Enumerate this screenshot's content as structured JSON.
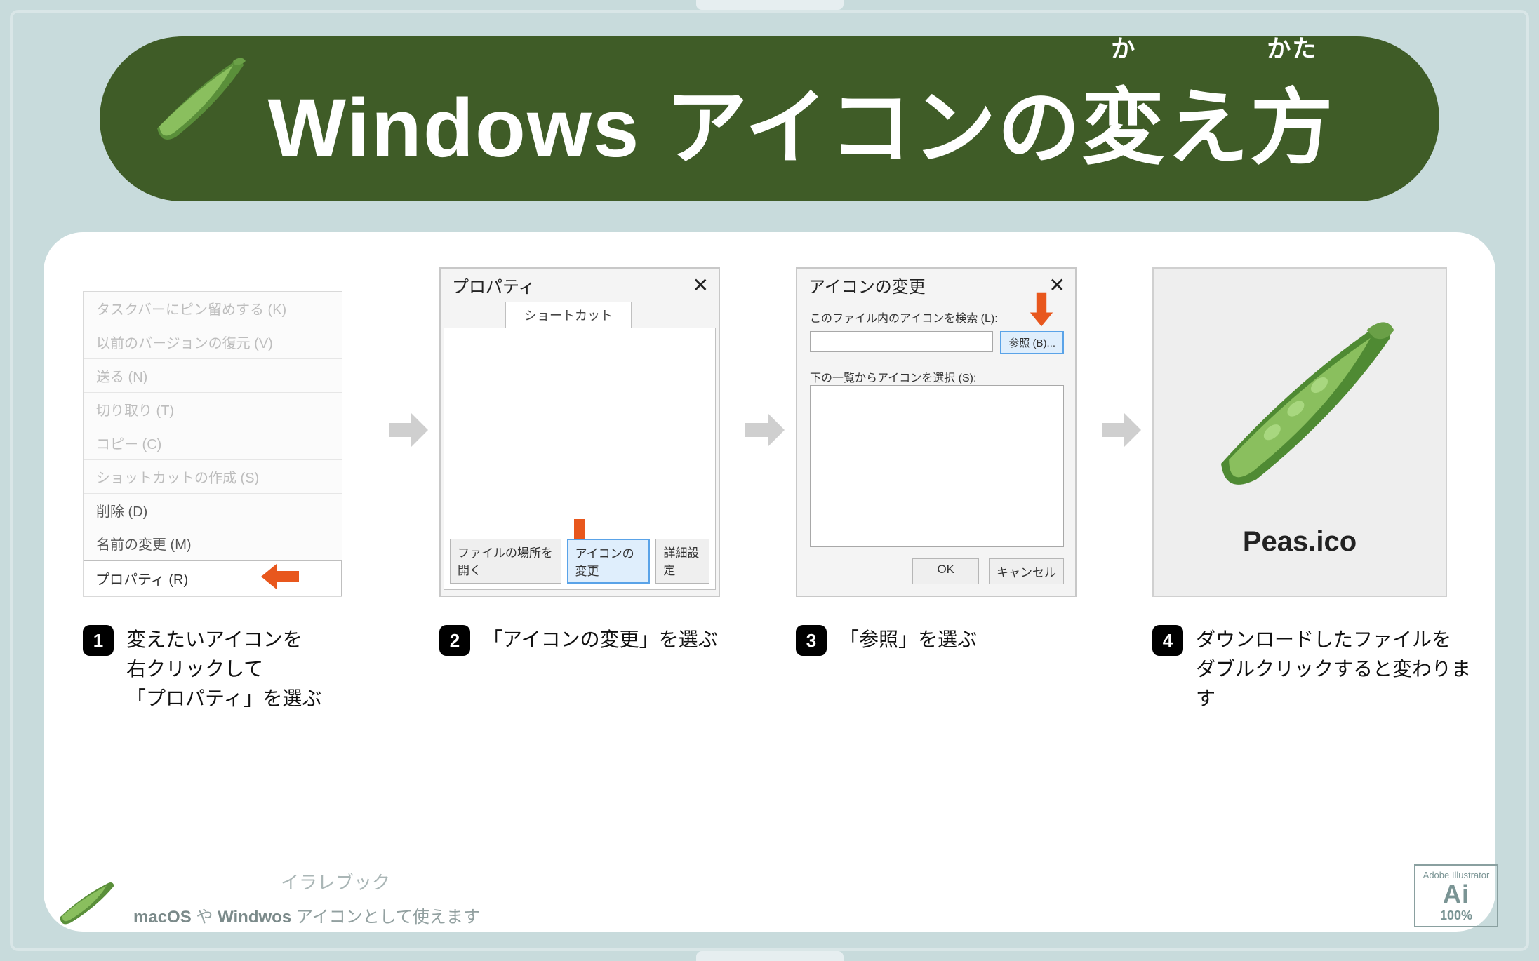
{
  "title": {
    "main": "Windows アイコンの",
    "ruby1_base": "変",
    "ruby1_kana": "か",
    "middle": "え",
    "ruby2_base": "方",
    "ruby2_kana": "かた"
  },
  "steps": {
    "s1": {
      "num": "1",
      "caption_l1": "変えたいアイコンを",
      "caption_l2": "右クリックして",
      "caption_l3": "「プロパティ」を選ぶ",
      "menu": {
        "pin": "タスクバーにピン留めする (K)",
        "restore": "以前のバージョンの復元 (V)",
        "send": "送る (N)",
        "cut": "切り取り (T)",
        "copy": "コピー (C)",
        "shortcut": "ショットカットの作成 (S)",
        "delete": "削除 (D)",
        "rename": "名前の変更 (M)",
        "props": "プロパティ (R)"
      }
    },
    "s2": {
      "num": "2",
      "caption": "「アイコンの変更」を選ぶ",
      "dlg_title": "プロパティ",
      "tab": "ショートカット",
      "btn_open": "ファイルの場所を開く",
      "btn_change": "アイコンの変更",
      "btn_adv": "詳細設定"
    },
    "s3": {
      "num": "3",
      "caption": "「参照」を選ぶ",
      "dlg_title": "アイコンの変更",
      "label_search": "このファイル内のアイコンを検索 (L):",
      "btn_browse": "参照 (B)...",
      "label_select": "下の一覧からアイコンを選択 (S):",
      "btn_ok": "OK",
      "btn_cancel": "キャンセル"
    },
    "s4": {
      "num": "4",
      "caption_l1": "ダウンロードしたファイルを",
      "caption_l2": "ダブルクリックすると変わります",
      "filename": "Peas.ico"
    }
  },
  "footer": {
    "brand": "イラレブック",
    "sub_b1": "macOS",
    "sub_mid": " や ",
    "sub_b2": "Windwos",
    "sub_tail": " アイコンとして使えます",
    "ai_small": "Adobe Illustrator",
    "ai_big": "Ai",
    "ai_pct": "100%"
  }
}
